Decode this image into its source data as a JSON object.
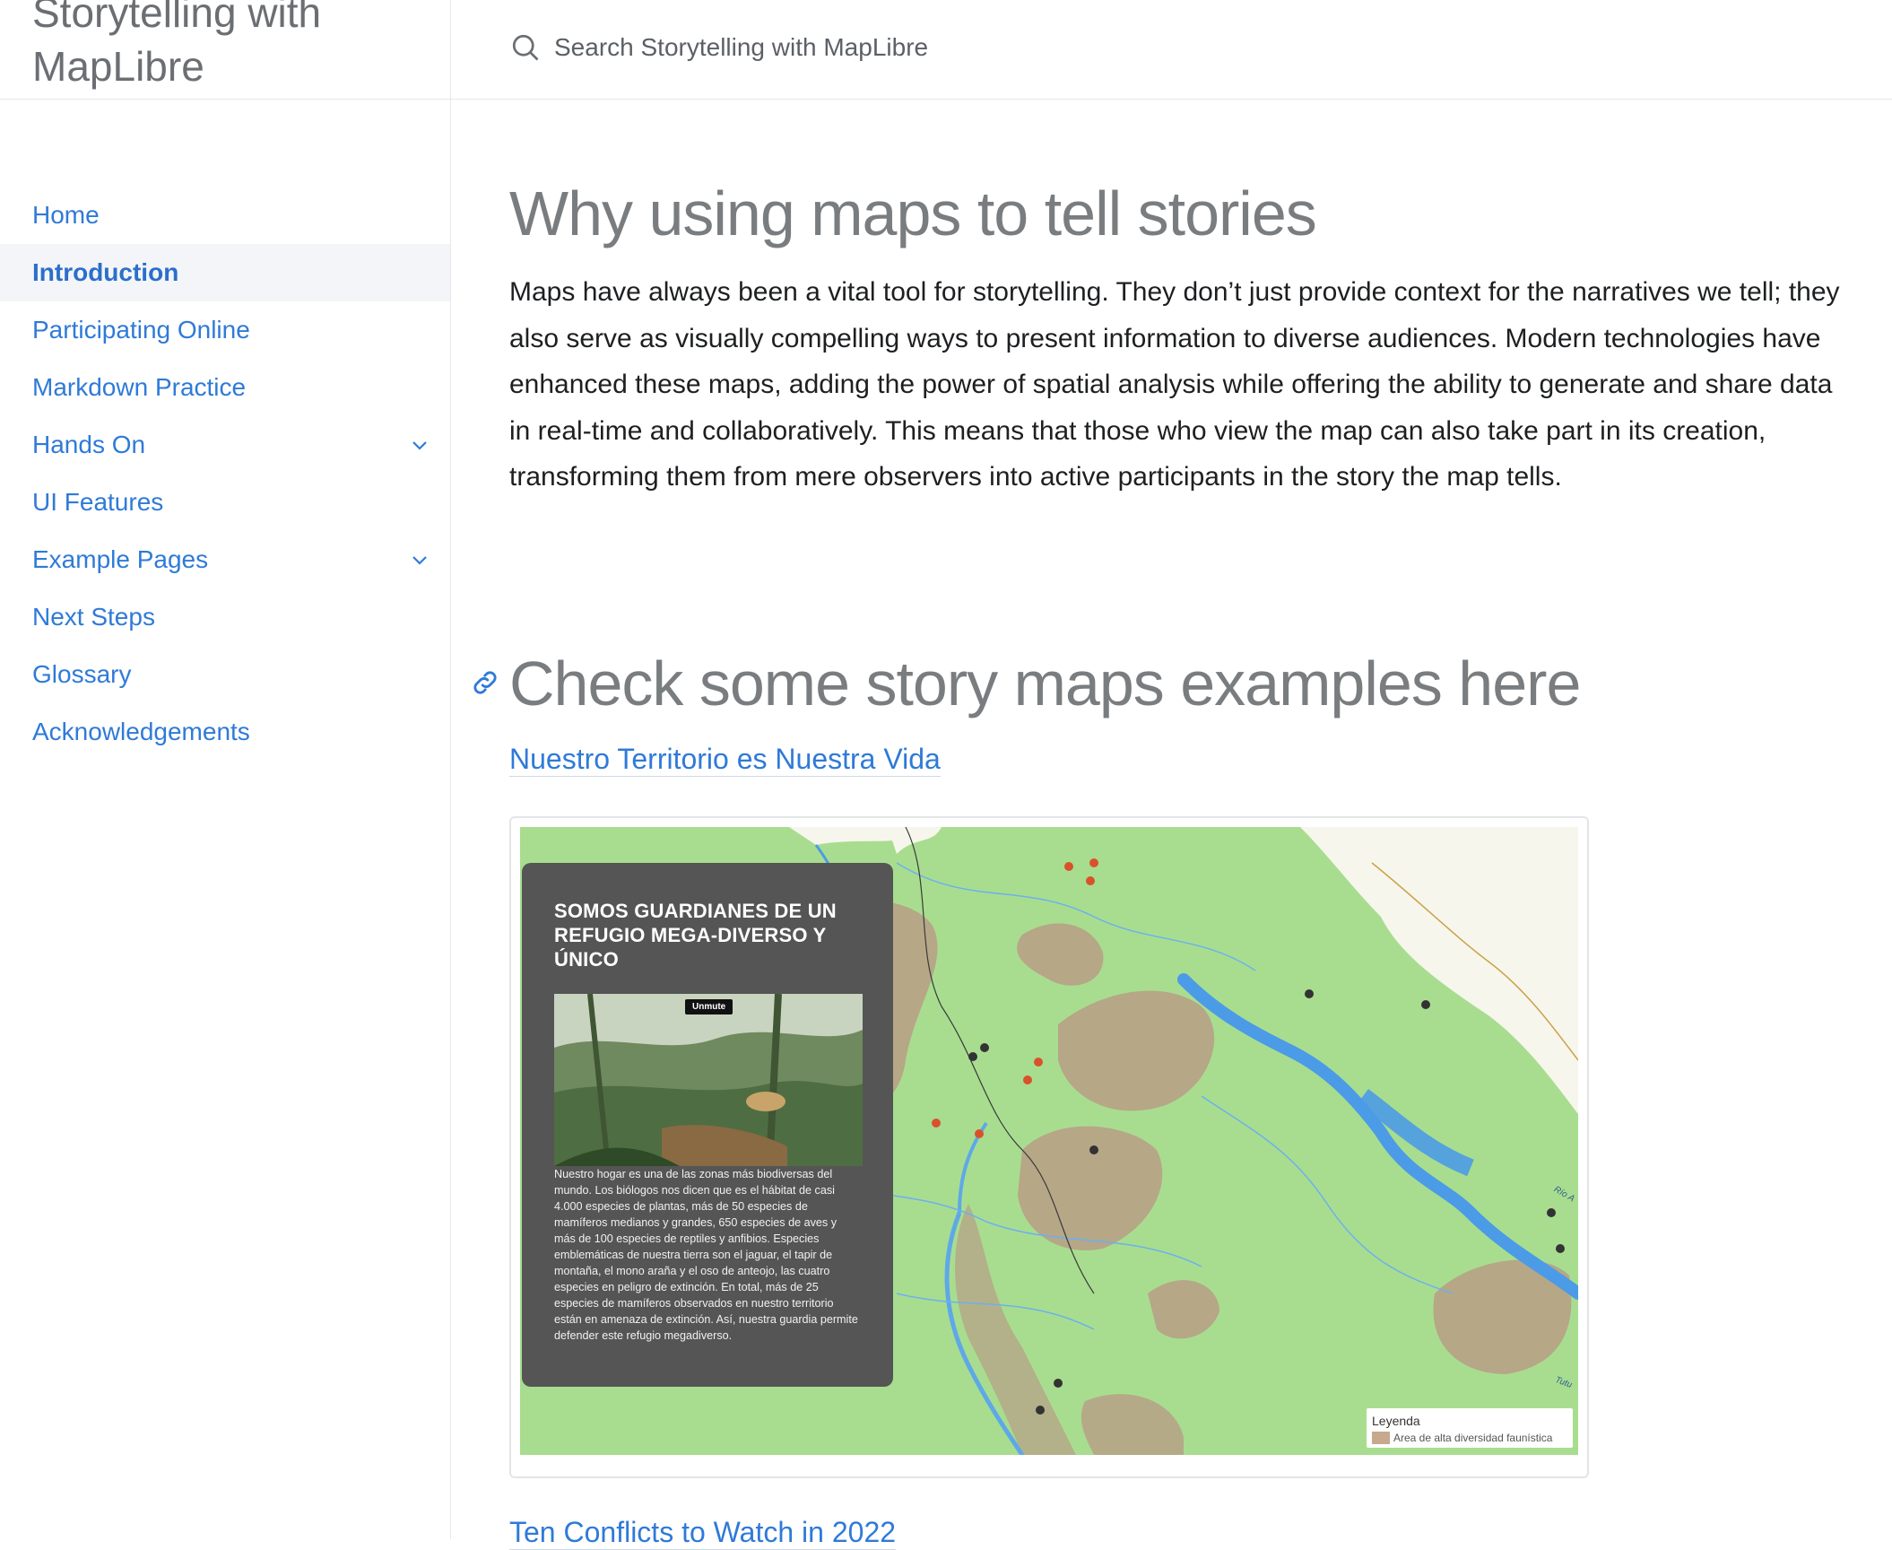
{
  "header": {
    "site_title": "Storytelling with MapLibre",
    "search_placeholder": "Search Storytelling with MapLibre"
  },
  "sidebar": {
    "items": [
      {
        "label": "Home"
      },
      {
        "label": "Introduction",
        "active": true
      },
      {
        "label": "Participating Online"
      },
      {
        "label": "Markdown Practice"
      },
      {
        "label": "Hands On",
        "expandable": true
      },
      {
        "label": "UI Features"
      },
      {
        "label": "Example Pages",
        "expandable": true
      },
      {
        "label": "Next Steps"
      },
      {
        "label": "Glossary"
      },
      {
        "label": "Acknowledgements"
      }
    ]
  },
  "main": {
    "title": "Why using maps to tell stories",
    "intro": "Maps have always been a vital tool for storytelling. They don’t just provide context for the narratives we tell; they also serve as visually compelling ways to present information to diverse audiences. Modern technologies have enhanced these maps, adding the power of spatial analysis while offering the ability to generate and share data in real-time and collaboratively. This means that those who view the map can also take part in its creation, transforming them from mere observers into active participants in the story the map tells.",
    "section_title": "Check some story maps examples here",
    "examples": [
      {
        "label": "Nuestro Territorio es Nuestra Vida"
      },
      {
        "label": "Ten Conflicts to Watch in 2022"
      }
    ]
  },
  "story_map": {
    "card_title": "SOMOS GUARDIANES DE UN REFUGIO MEGA-DIVERSO Y ÚNICO",
    "unmute_label": "Unmute",
    "card_text": "Nuestro hogar es una de las zonas más biodiversas del mundo. Los biólogos nos dicen que es el hábitat de casi 4.000 especies de plantas, más de 50 especies de mamíferos medianos y grandes, 650 especies de aves y más de 100 especies de reptiles y anfibios. Especies emblemáticas de nuestra tierra son el jaguar, el tapir de montaña, el mono araña y el oso de anteojo, las cuatro especies en peligro de extinción. En total, más de 25 especies de mamíferos observados en nuestro territorio están en amenaza de extinción. Así, nuestra guardia permite defender este refugio megadiverso.",
    "legend_title": "Leyenda",
    "legend_item": "Area de alta diversidad faunística",
    "river_label_1": "Río A",
    "river_label_2": "Tutu"
  },
  "colors": {
    "link": "#2f7ad8",
    "land_green": "#a7dc8f",
    "biodiversity_area": "#b9a089",
    "river_blue": "#4b9be6"
  }
}
